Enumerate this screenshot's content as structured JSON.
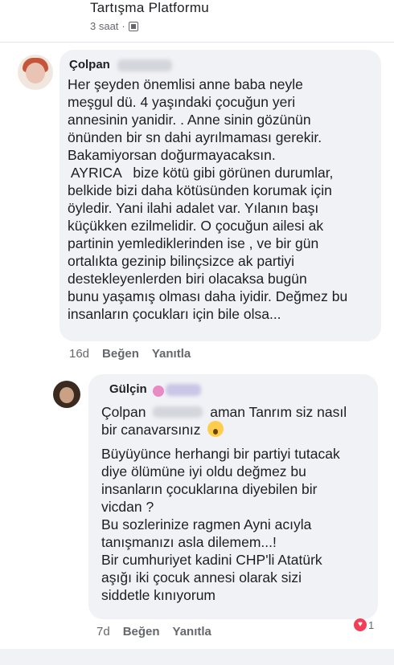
{
  "header": {
    "page_name": "Tartışma Platformu",
    "time": "3 saat",
    "separator": "·",
    "visibility_icon": "friends-list-icon"
  },
  "comment1": {
    "author": "Çolpan",
    "lines": [
      "Her şeyden önemlisi anne baba neyle",
      "meşgul dü. 4 yaşındaki çocuğun yeri",
      "annesinin yanidir. .  Anne sinin gözünün",
      "önünden  bir sn dahi ayrılmaması gerekir.",
      "Bakamiyorsan doğurmayacaksın.",
      " AYRICA   bize kötü gibi görünen durumlar,",
      "belkide bizi daha kötüsünden korumak için",
      "öyledir.  Yani ilahi adalet var. Yılanın başı",
      "küçükken ezilmelidir. O çocuğun  ailesi  ak",
      "partinin yemlediklerinden ise ,  ve bir gün",
      "ortalıkta  gezinip  bilinçsizce ak partiyi",
      "destekleyenlerden biri olacaksa  bugün",
      "bunu yaşamış olması daha iyidir. Değmez bu",
      "insanların çocukları için  bile olsa..."
    ],
    "time": "16d",
    "like": "Beğen",
    "reply": "Yanıtla"
  },
  "comment2": {
    "author": "Gülçin",
    "mention": "Çolpan",
    "first_line_rest": "aman Tanrım siz nasıl",
    "line2": "bir canavarsınız",
    "para2": [
      "Büyüyünce herhangi bir partiyi tutacak",
      "diye ölümüne iyi oldu değmez bu",
      "insanların çocuklarına diyebilen bir",
      "vicdan ?"
    ],
    "para3": [
      "Bu sozlerinize ragmen Ayni acıyla",
      "tanışmanızı asla dilemem...!",
      "Bir cumhuriyet kadini CHP'li Atatürk",
      "aşığı iki çocuk annesi olarak sizi",
      "siddetle kınıyorum"
    ],
    "time": "7d",
    "like": "Beğen",
    "reply": "Yanıtla",
    "reaction_count": "1"
  },
  "colors": {
    "bubble": "#f0f2f5",
    "meta": "#65676b",
    "text": "#1c1e21",
    "reaction": "#f33e58"
  }
}
